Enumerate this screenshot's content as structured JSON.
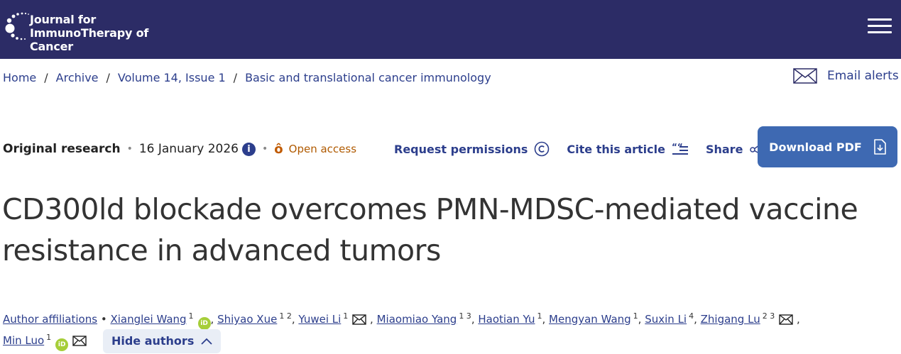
{
  "header": {
    "journal_line1": "Journal for",
    "journal_line2": "ImmunoTherapy of Cancer",
    "menu_icon": "hamburger-menu-icon",
    "background": "#2c2c66"
  },
  "breadcrumb": {
    "items": [
      "Home",
      "Archive",
      "Volume 14, Issue 1",
      "Basic and translational cancer immunology"
    ],
    "separator": "/"
  },
  "alerts": {
    "label": "Email alerts",
    "icon": "envelope-icon"
  },
  "meta": {
    "article_type": "Original research",
    "date": "16 January 2026",
    "info_icon": "info-icon",
    "access": "Open access",
    "access_icon": "open-lock-icon"
  },
  "actions": {
    "request_permissions": "Request permissions",
    "cite": "Cite this article",
    "share": "Share",
    "download_pdf": "Download PDF"
  },
  "article": {
    "title": "CD300ld blockade overcomes PMN-MDSC-mediated vaccine resistance in advanced tumors"
  },
  "authors": {
    "affiliations_label": "Author affiliations",
    "list": [
      {
        "name": "Xianglei Wang",
        "sup": "1"
      },
      {
        "name": "Shiyao Xue",
        "sup": "1 2"
      },
      {
        "name": "Yuwei Li",
        "sup": "1"
      },
      {
        "name": "Miaomiao Yang",
        "sup": "1 3"
      },
      {
        "name": "Haotian Yu",
        "sup": "1"
      },
      {
        "name": "Mengyan Wang",
        "sup": "1"
      },
      {
        "name": "Suxin Li",
        "sup": "4"
      },
      {
        "name": "Zhigang Lu",
        "sup": "2 3"
      },
      {
        "name": "Min Luo",
        "sup": "1"
      }
    ],
    "orcid_label": "iD",
    "hide_label": "Hide authors"
  },
  "colors": {
    "link": "#2c3e8c",
    "button": "#3e69b2",
    "open_access": "#b05a00",
    "orcid": "#a6ce39"
  }
}
